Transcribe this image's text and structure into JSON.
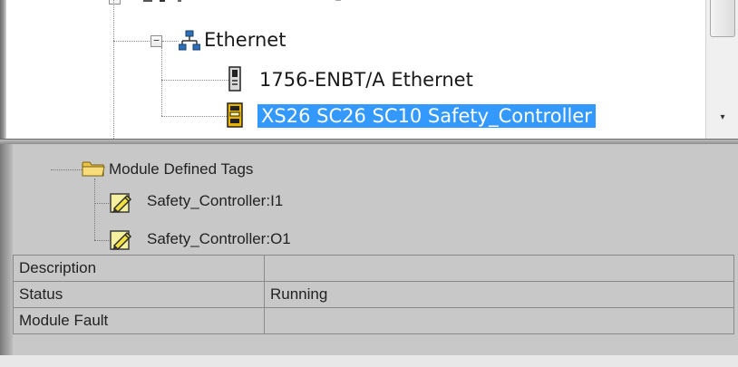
{
  "tree": {
    "items": [
      {
        "label": "Ethernet",
        "icon": "network-icon",
        "expander": "−"
      },
      {
        "label": "1756-ENBT/A Ethernet",
        "icon": "module-icon"
      },
      {
        "label": "XS26 SC26 SC10 Safety_Controller",
        "icon": "safety-module-icon",
        "selected": true
      }
    ],
    "scroll_down_glyph": "▾"
  },
  "tags": {
    "folder_label": "Module Defined Tags",
    "items": [
      {
        "label": "Safety_Controller:I1",
        "icon": "tag-icon"
      },
      {
        "label": "Safety_Controller:O1",
        "icon": "tag-icon"
      }
    ]
  },
  "properties": [
    {
      "label": "Description",
      "value": ""
    },
    {
      "label": "Status",
      "value": "Running"
    },
    {
      "label": "Module Fault",
      "value": ""
    }
  ],
  "colors": {
    "selection": "#3399ff",
    "pane_bg": "#c8c8c8",
    "folder": "#f2d35a",
    "tag_pencil": "#f0e040"
  }
}
